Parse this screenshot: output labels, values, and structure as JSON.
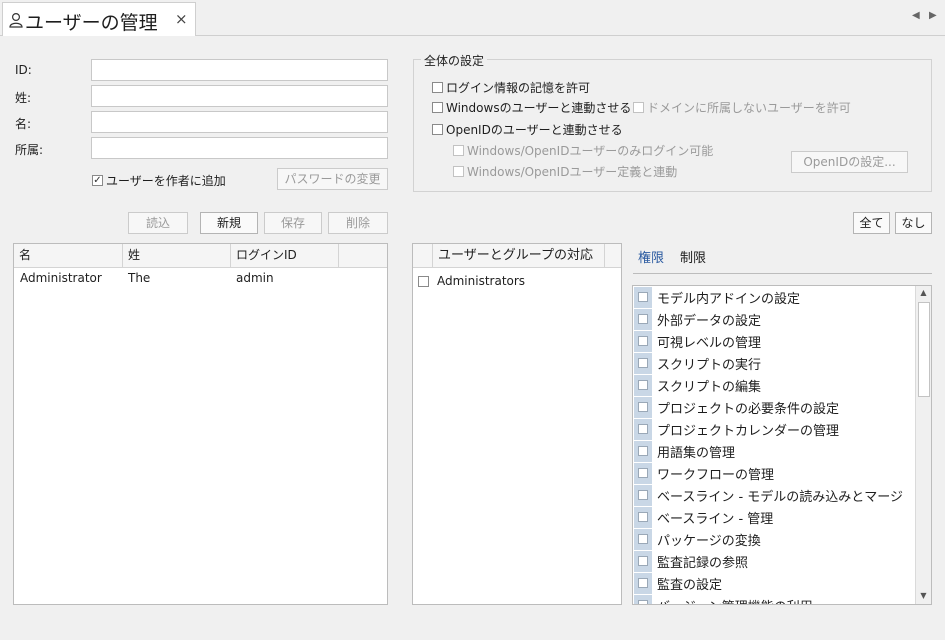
{
  "window": {
    "tab_title": "ユーザーの管理",
    "close_glyph": "×",
    "nav_prev": "◀",
    "nav_next": "▶"
  },
  "form": {
    "id_label": "ID:",
    "lastname_label": "姓:",
    "firstname_label": "名:",
    "dept_label": "所属:",
    "id_value": "",
    "lastname_value": "",
    "firstname_value": "",
    "dept_value": "",
    "add_author_label": "ユーザーを作者に追加",
    "add_author_checked": "✓",
    "password_button": "パスワードの変更"
  },
  "global_settings": {
    "legend": "全体の設定",
    "remember_login": "ログイン情報の記憶を許可",
    "windows_user_link": "Windowsのユーザーと連動させる",
    "allow_non_domain": "ドメインに所属しないユーザーを許可",
    "openid_link": "OpenIDのユーザーと連動させる",
    "openid_only_login": "Windows/OpenIDユーザーのみログイン可能",
    "openid_user_def": "Windows/OpenIDユーザー定義と連動",
    "openid_settings_button": "OpenIDの設定..."
  },
  "actions": {
    "load": "読込",
    "new": "新規",
    "save": "保存",
    "delete": "削除",
    "all": "全て",
    "none": "なし"
  },
  "user_table": {
    "columns": [
      "名",
      "姓",
      "ログインID"
    ],
    "rows": [
      {
        "first": "Administrator",
        "last": "The",
        "login": "admin"
      }
    ]
  },
  "group_panel": {
    "header": "ユーザーとグループの対応",
    "items": [
      "Administrators"
    ]
  },
  "rights_panel": {
    "tabs": [
      "権限",
      "制限"
    ],
    "items": [
      "モデル内アドインの設定",
      "外部データの設定",
      "可視レベルの管理",
      "スクリプトの実行",
      "スクリプトの編集",
      "プロジェクトの必要条件の設定",
      "プロジェクトカレンダーの管理",
      "用語集の管理",
      "ワークフローの管理",
      "ベースライン - モデルの読み込みとマージ",
      "ベースライン - 管理",
      "パッケージの変換",
      "監査記録の参照",
      "監査の設定",
      "バージョン管理機能の利用"
    ],
    "scroll_up": "▲",
    "scroll_down": "▼"
  },
  "colors": {
    "active_tab": "#2a5aa0",
    "checkbox_column": "#c9d7e6"
  }
}
